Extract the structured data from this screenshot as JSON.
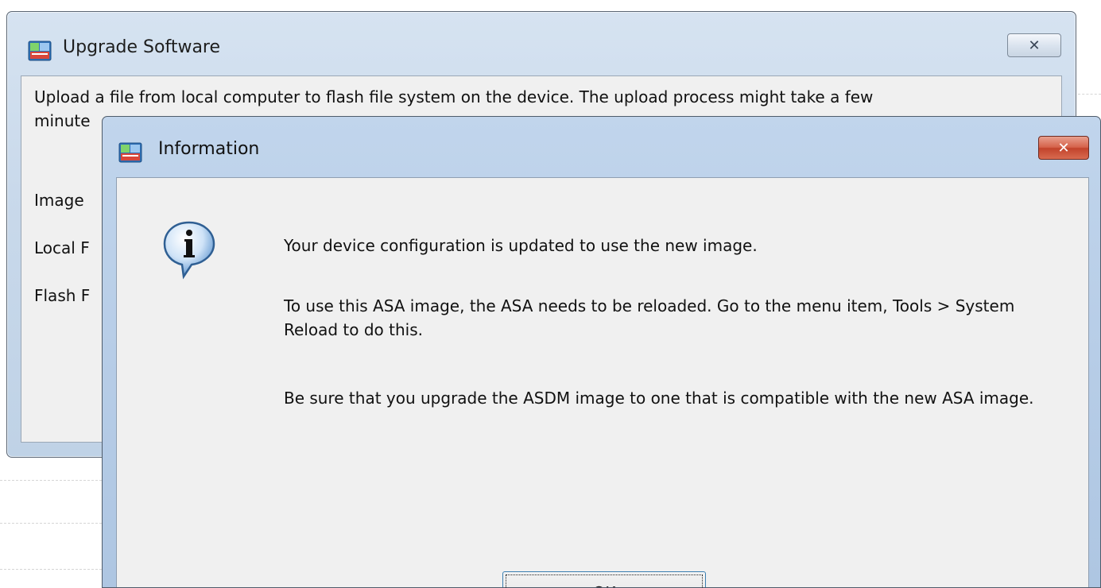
{
  "upgrade_window": {
    "title": "Upgrade Software",
    "close_glyph": "✕",
    "description_line1": "Upload a file from local computer to flash file system on the device. The upload process might take a few",
    "description_line2": "minute",
    "labels": [
      "Image",
      "Local F",
      "Flash F"
    ]
  },
  "info_dialog": {
    "title": "Information",
    "close_glyph": "✕",
    "icon": "info-icon",
    "messages": [
      "Your device configuration is updated to use the new image.",
      "To use this ASA image, the ASA needs to be reloaded. Go to the menu item, Tools > System Reload to do this.",
      "Be sure that you upgrade the ASDM image to one that is compatible with the new ASA image."
    ],
    "ok_label": "OK"
  }
}
